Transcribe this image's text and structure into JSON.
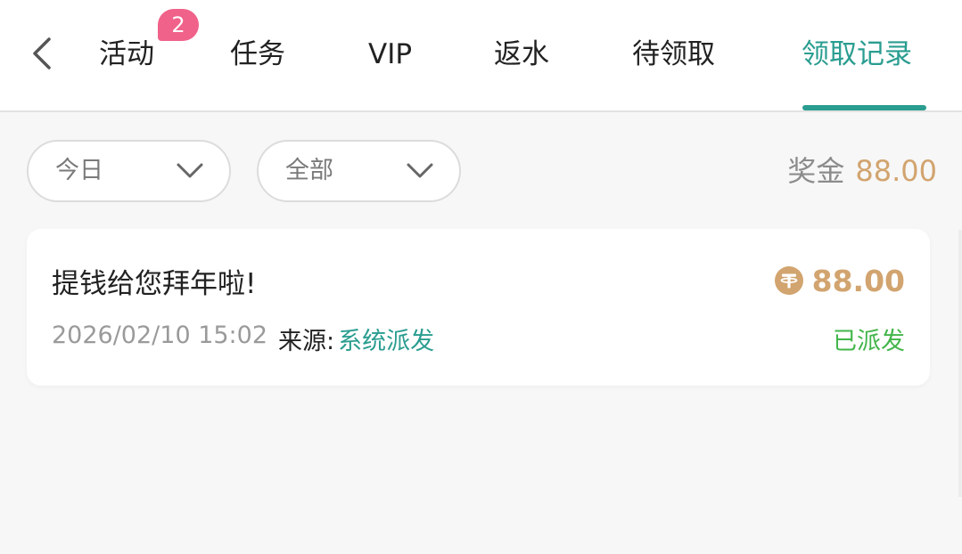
{
  "header": {
    "tabs": [
      {
        "label": "活动"
      },
      {
        "label": "任务"
      },
      {
        "label": "VIP"
      },
      {
        "label": "返水"
      },
      {
        "label": "待领取"
      },
      {
        "label": "领取记录"
      }
    ],
    "badge_count": "2",
    "active_tab": "领取记录",
    "back_icon": "chevron-left-icon",
    "accent_color": "#2a9d90",
    "badge_color": "#f0628a"
  },
  "filters": {
    "date_label": "今日",
    "type_label": "全部",
    "chevron_icon": "chevron-down-icon"
  },
  "summary": {
    "label": "奖金",
    "value": "88.00",
    "value_color": "#d2a46f"
  },
  "records": [
    {
      "title": "提钱给您拜年啦!",
      "amount": "88.00",
      "currency_icon": "usdt-coin-icon",
      "timestamp": "2026/02/10 15:02",
      "source_label": "来源:",
      "source_value": "系统派发",
      "status": "已派发",
      "status_color": "#43b54a"
    }
  ]
}
